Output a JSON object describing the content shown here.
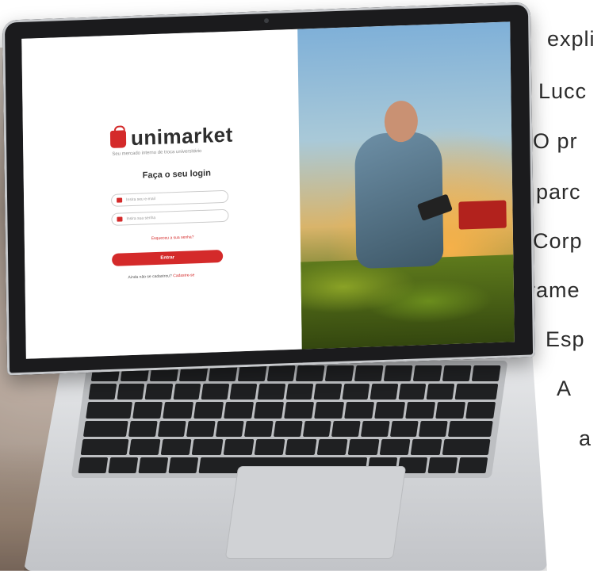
{
  "side_text": {
    "lines": [
      "expli",
      "Lucc",
      "O pr",
      "parc",
      "Corp",
      "rame",
      "Esp",
      "A",
      "a"
    ]
  },
  "login": {
    "brand": "unimarket",
    "tagline": "Seu mercado interno de troca universitário",
    "title": "Faça o seu login",
    "email_placeholder": "Insira seu e-mail",
    "password_placeholder": "Insira sua senha",
    "forgot": "Esqueceu a sua senha?",
    "button": "Entrar",
    "signup_prefix": "Ainda não se cadastrou?",
    "signup_link": "Cadastre-se"
  },
  "colors": {
    "brand": "#d42a2a"
  }
}
